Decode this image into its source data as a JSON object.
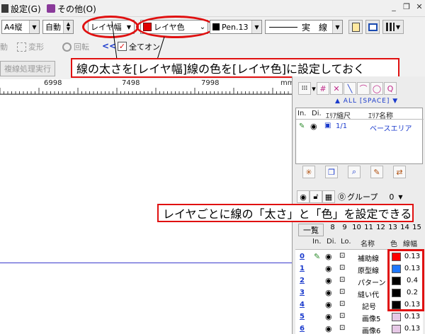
{
  "menu": {
    "settings": "設定(G)",
    "other": "その他(O)"
  },
  "window_controls": {
    "minimize": "_",
    "restore": "❐"
  },
  "toolbar1": {
    "paper": "A4縦",
    "auto": "自動",
    "line_width": "レイヤ幅",
    "line_color": "レイヤ色",
    "pen": "Pen.13",
    "line_type": "実　線"
  },
  "toolbar2": {
    "move": "動",
    "transform": "変形",
    "rotate": "回転",
    "collapse": "<<",
    "all_on": "全てオン"
  },
  "toolbar3": {
    "batch": "複線処理実行"
  },
  "callout1": "線の太さを[レイヤ幅]線の色を[レイヤ色]に設定しておく",
  "callout2": "レイヤごとに線の「太さ」と「色」を設定できる",
  "ruler": {
    "labels": [
      "6998",
      "7498",
      "7998"
    ],
    "unit": "mm"
  },
  "panel": {
    "all_space": "▲ ALL [SPACE] ▼",
    "area_headers": [
      "In.",
      "Di.",
      "ｴﾘｱ縮尺",
      "ｴﾘｱ名称"
    ],
    "area_row": {
      "scale": "1/1",
      "name": "ベースエリア"
    },
    "group_label": "グループ",
    "group_value": "0",
    "list_button": "一覧",
    "column_numbers": [
      "8",
      "9",
      "10",
      "11",
      "12",
      "13",
      "14",
      "15"
    ],
    "layer_headers": {
      "in": "In.",
      "di": "Di.",
      "lo": "Lo.",
      "name": "名称",
      "color": "色",
      "width": "線幅"
    },
    "layers": [
      {
        "num": "0",
        "name": "補助線",
        "color": "#ff0000",
        "width": "0.13"
      },
      {
        "num": "1",
        "name": "原型線",
        "color": "#1e78ff",
        "width": "0.13"
      },
      {
        "num": "2",
        "name": "パターン",
        "color": "#000000",
        "width": "0.4"
      },
      {
        "num": "3",
        "name": "縫い代",
        "color": "#000000",
        "width": "0.2"
      },
      {
        "num": "4",
        "name": "記号",
        "color": "#000000",
        "width": "0.13"
      },
      {
        "num": "5",
        "name": "画像5",
        "color": "#e6c8e6",
        "width": "0.13"
      },
      {
        "num": "6",
        "name": "画像6",
        "color": "#e6c8e6",
        "width": "0.13"
      }
    ]
  },
  "colors": {
    "accent_red": "#e01010",
    "link_blue": "#1a3acc",
    "drawing_line": "#3a3acc"
  }
}
